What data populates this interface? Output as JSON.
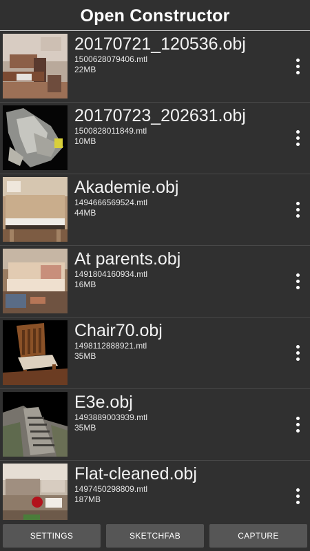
{
  "header": {
    "title": "Open Constructor"
  },
  "files": [
    {
      "name": "20170721_120536.obj",
      "mtl": "1500628079406.mtl",
      "size": "22MB",
      "thumb": "room-table-icon"
    },
    {
      "name": "20170723_202631.obj",
      "mtl": "1500828011849.mtl",
      "size": "10MB",
      "thumb": "scan-mesh-icon"
    },
    {
      "name": "Akademie.obj",
      "mtl": "1494666569524.mtl",
      "size": "44MB",
      "thumb": "piano-icon"
    },
    {
      "name": "At parents.obj",
      "mtl": "1491804160934.mtl",
      "size": "16MB",
      "thumb": "sofa-icon"
    },
    {
      "name": "Chair70.obj",
      "mtl": "1498112888921.mtl",
      "size": "35MB",
      "thumb": "chair-icon"
    },
    {
      "name": "E3e.obj",
      "mtl": "1493889003939.mtl",
      "size": "35MB",
      "thumb": "stairs-icon"
    },
    {
      "name": "Flat-cleaned.obj",
      "mtl": "1497450298809.mtl",
      "size": "187MB",
      "thumb": "living-room-icon"
    }
  ],
  "buttons": {
    "settings": "SETTINGS",
    "sketchfab": "SKETCHFAB",
    "capture": "CAPTURE"
  },
  "colors": {
    "background": "#303030",
    "button": "#565656",
    "text": "#ffffff"
  }
}
